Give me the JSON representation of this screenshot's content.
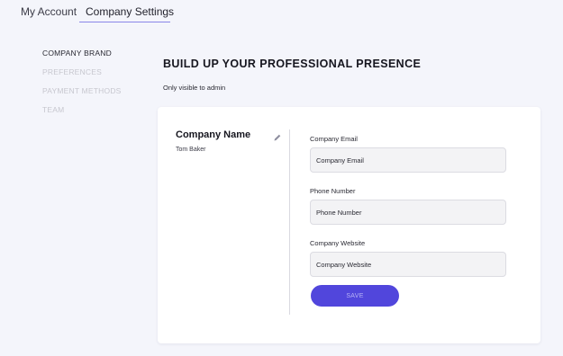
{
  "tabs": [
    {
      "label": "My Account"
    },
    {
      "label": "Company Settings",
      "active": true
    }
  ],
  "sidebar": {
    "items": [
      {
        "label": "COMPANY BRAND",
        "active": true
      },
      {
        "label": "PREFERENCES"
      },
      {
        "label": "PAYMENT METHODS"
      },
      {
        "label": "TEAM"
      }
    ]
  },
  "main": {
    "title": "BUILD UP YOUR PROFESSIONAL PRESENCE",
    "subtitle": "Only visible to admin"
  },
  "company": {
    "name": "Company Name",
    "owner": "Tom Baker",
    "edit_icon": "pencil-icon"
  },
  "form": {
    "email": {
      "label": "Company Email",
      "placeholder": "Company Email"
    },
    "phone": {
      "label": "Phone Number",
      "placeholder": "Phone Number"
    },
    "website": {
      "label": "Company Website",
      "placeholder": "Company Website"
    },
    "save_label": "SAVE"
  },
  "colors": {
    "accent": "#5146dc",
    "background": "#f4f5fb",
    "muted": "#c7c7cf"
  }
}
